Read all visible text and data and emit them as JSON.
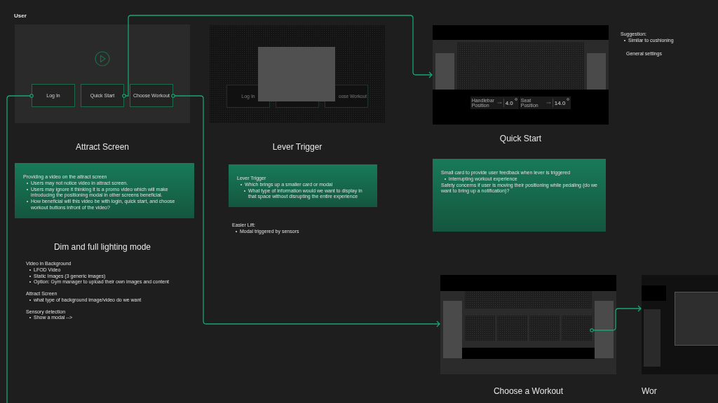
{
  "canvas_label": "User",
  "frames": [
    {
      "kind": "attract",
      "title": "Attract Screen",
      "buttons": [
        {
          "label": "Log In"
        },
        {
          "label": "Quick Start"
        },
        {
          "label": "Choose Workout"
        }
      ]
    },
    {
      "kind": "lever",
      "title": "Lever Trigger",
      "visible_labels": [
        "Log In",
        "oose Workout"
      ]
    },
    {
      "kind": "quickstart",
      "title": "Quick Start",
      "readouts": [
        {
          "label": "Handlebar Position",
          "value": "4.0"
        },
        {
          "label": "Seat Position",
          "value": "14.0"
        }
      ]
    },
    {
      "kind": "choose",
      "title": "Choose a Workout"
    },
    {
      "kind": "workout",
      "title": "Wor"
    }
  ],
  "notes": [
    {
      "kind": "card",
      "items": [
        {
          "text": "Providing a video on the attract screen",
          "children": [
            {
              "text": "Users may not notice video in attract screen."
            },
            {
              "text": "Users may ignore it thinking it is a promo video which will make introducing the positioning modal in other screens beneficial."
            },
            {
              "text": "How beneficial will this video be with login, quick start, and choose workout buttons infront of the video?"
            }
          ]
        }
      ]
    },
    {
      "kind": "heading",
      "items": [
        {
          "text": "Dim and full lighting mode"
        }
      ]
    },
    {
      "kind": "plain",
      "items": [
        {
          "text": "Video in Background",
          "children": [
            {
              "text": "LFOD Video"
            },
            {
              "text": "Static Images (3 generic images)"
            },
            {
              "text": "Option: Gym manager to upload their own images and content"
            }
          ]
        },
        {
          "text": "Attract Screen",
          "children": [
            {
              "text": "what type of background image/video do we want"
            }
          ]
        },
        {
          "text": "Sensory detection",
          "children": [
            {
              "text": "Show a modal -->"
            }
          ]
        }
      ]
    },
    {
      "kind": "card",
      "items": [
        {
          "text": "Lever Trigger",
          "children": [
            {
              "text": "Which brings up a smaller card or modal",
              "children": [
                {
                  "text": "What type of information would we want to display in that space without disrupting the entire experience"
                }
              ]
            }
          ]
        }
      ]
    },
    {
      "kind": "plain",
      "items": [
        {
          "text": "Easier Lift:",
          "children": [
            {
              "text": "Modal triggered by sensors"
            }
          ]
        }
      ]
    },
    {
      "kind": "card",
      "items": [
        {
          "text": "Small card to provide user feedback when lever is triggered",
          "children": [
            {
              "text": "interrupting workout experience"
            }
          ]
        },
        {
          "text": "Safety concerns if user is moving their positioning while pedaling (do we want to bring up a notification)?"
        }
      ]
    },
    {
      "kind": "plain",
      "items": [
        {
          "text": "Suggestion:",
          "children": [
            {
              "text": "Similar to cushioning"
            }
          ]
        }
      ]
    },
    {
      "kind": "plain",
      "items": [
        {
          "text": "General settings"
        }
      ]
    }
  ]
}
